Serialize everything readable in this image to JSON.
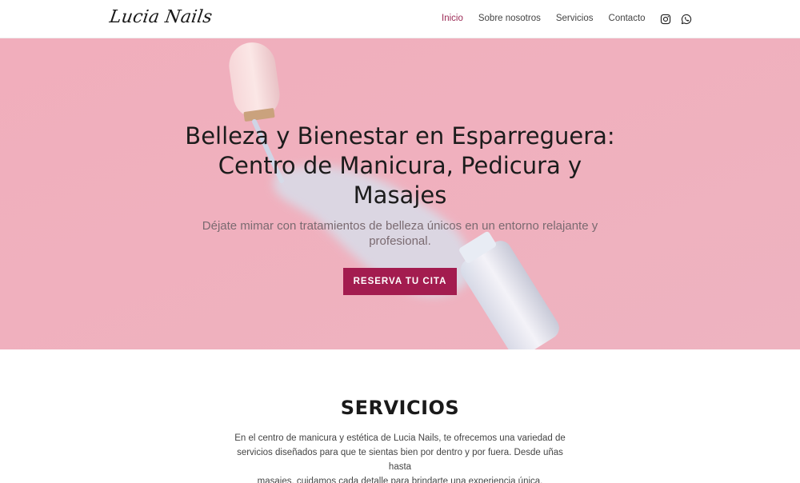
{
  "brand": {
    "logo_text": "Lucia Nails"
  },
  "nav": {
    "items": [
      {
        "label": "Inicio",
        "active": true
      },
      {
        "label": "Sobre nosotros",
        "active": false
      },
      {
        "label": "Servicios",
        "active": false
      },
      {
        "label": "Contacto",
        "active": false
      }
    ]
  },
  "social": {
    "icons": [
      "instagram-icon",
      "whatsapp-icon"
    ]
  },
  "hero": {
    "title_lines": [
      "Belleza y Bienestar en Esparreguera:",
      "Centro de Manicura, Pedicura y",
      "Masajes"
    ],
    "subtitle_lines": [
      "Déjate mimar con tratamientos de belleza únicos en un entorno relajante y",
      "profesional."
    ],
    "cta_label": "RESERVA TU CITA"
  },
  "services": {
    "title": "SERVICIOS",
    "text_lines": [
      "En el centro de manicura y estética de Lucia Nails, te ofrecemos una variedad de",
      "servicios diseñados para que te sientas bien por dentro y por fuera. Desde uñas hasta",
      "masajes, cuidamos cada detalle para brindarte una experiencia única."
    ]
  },
  "colors": {
    "accent": "#a31c4f",
    "nav_active": "#9b2a55",
    "hero_bg": "#f0b1bf"
  }
}
